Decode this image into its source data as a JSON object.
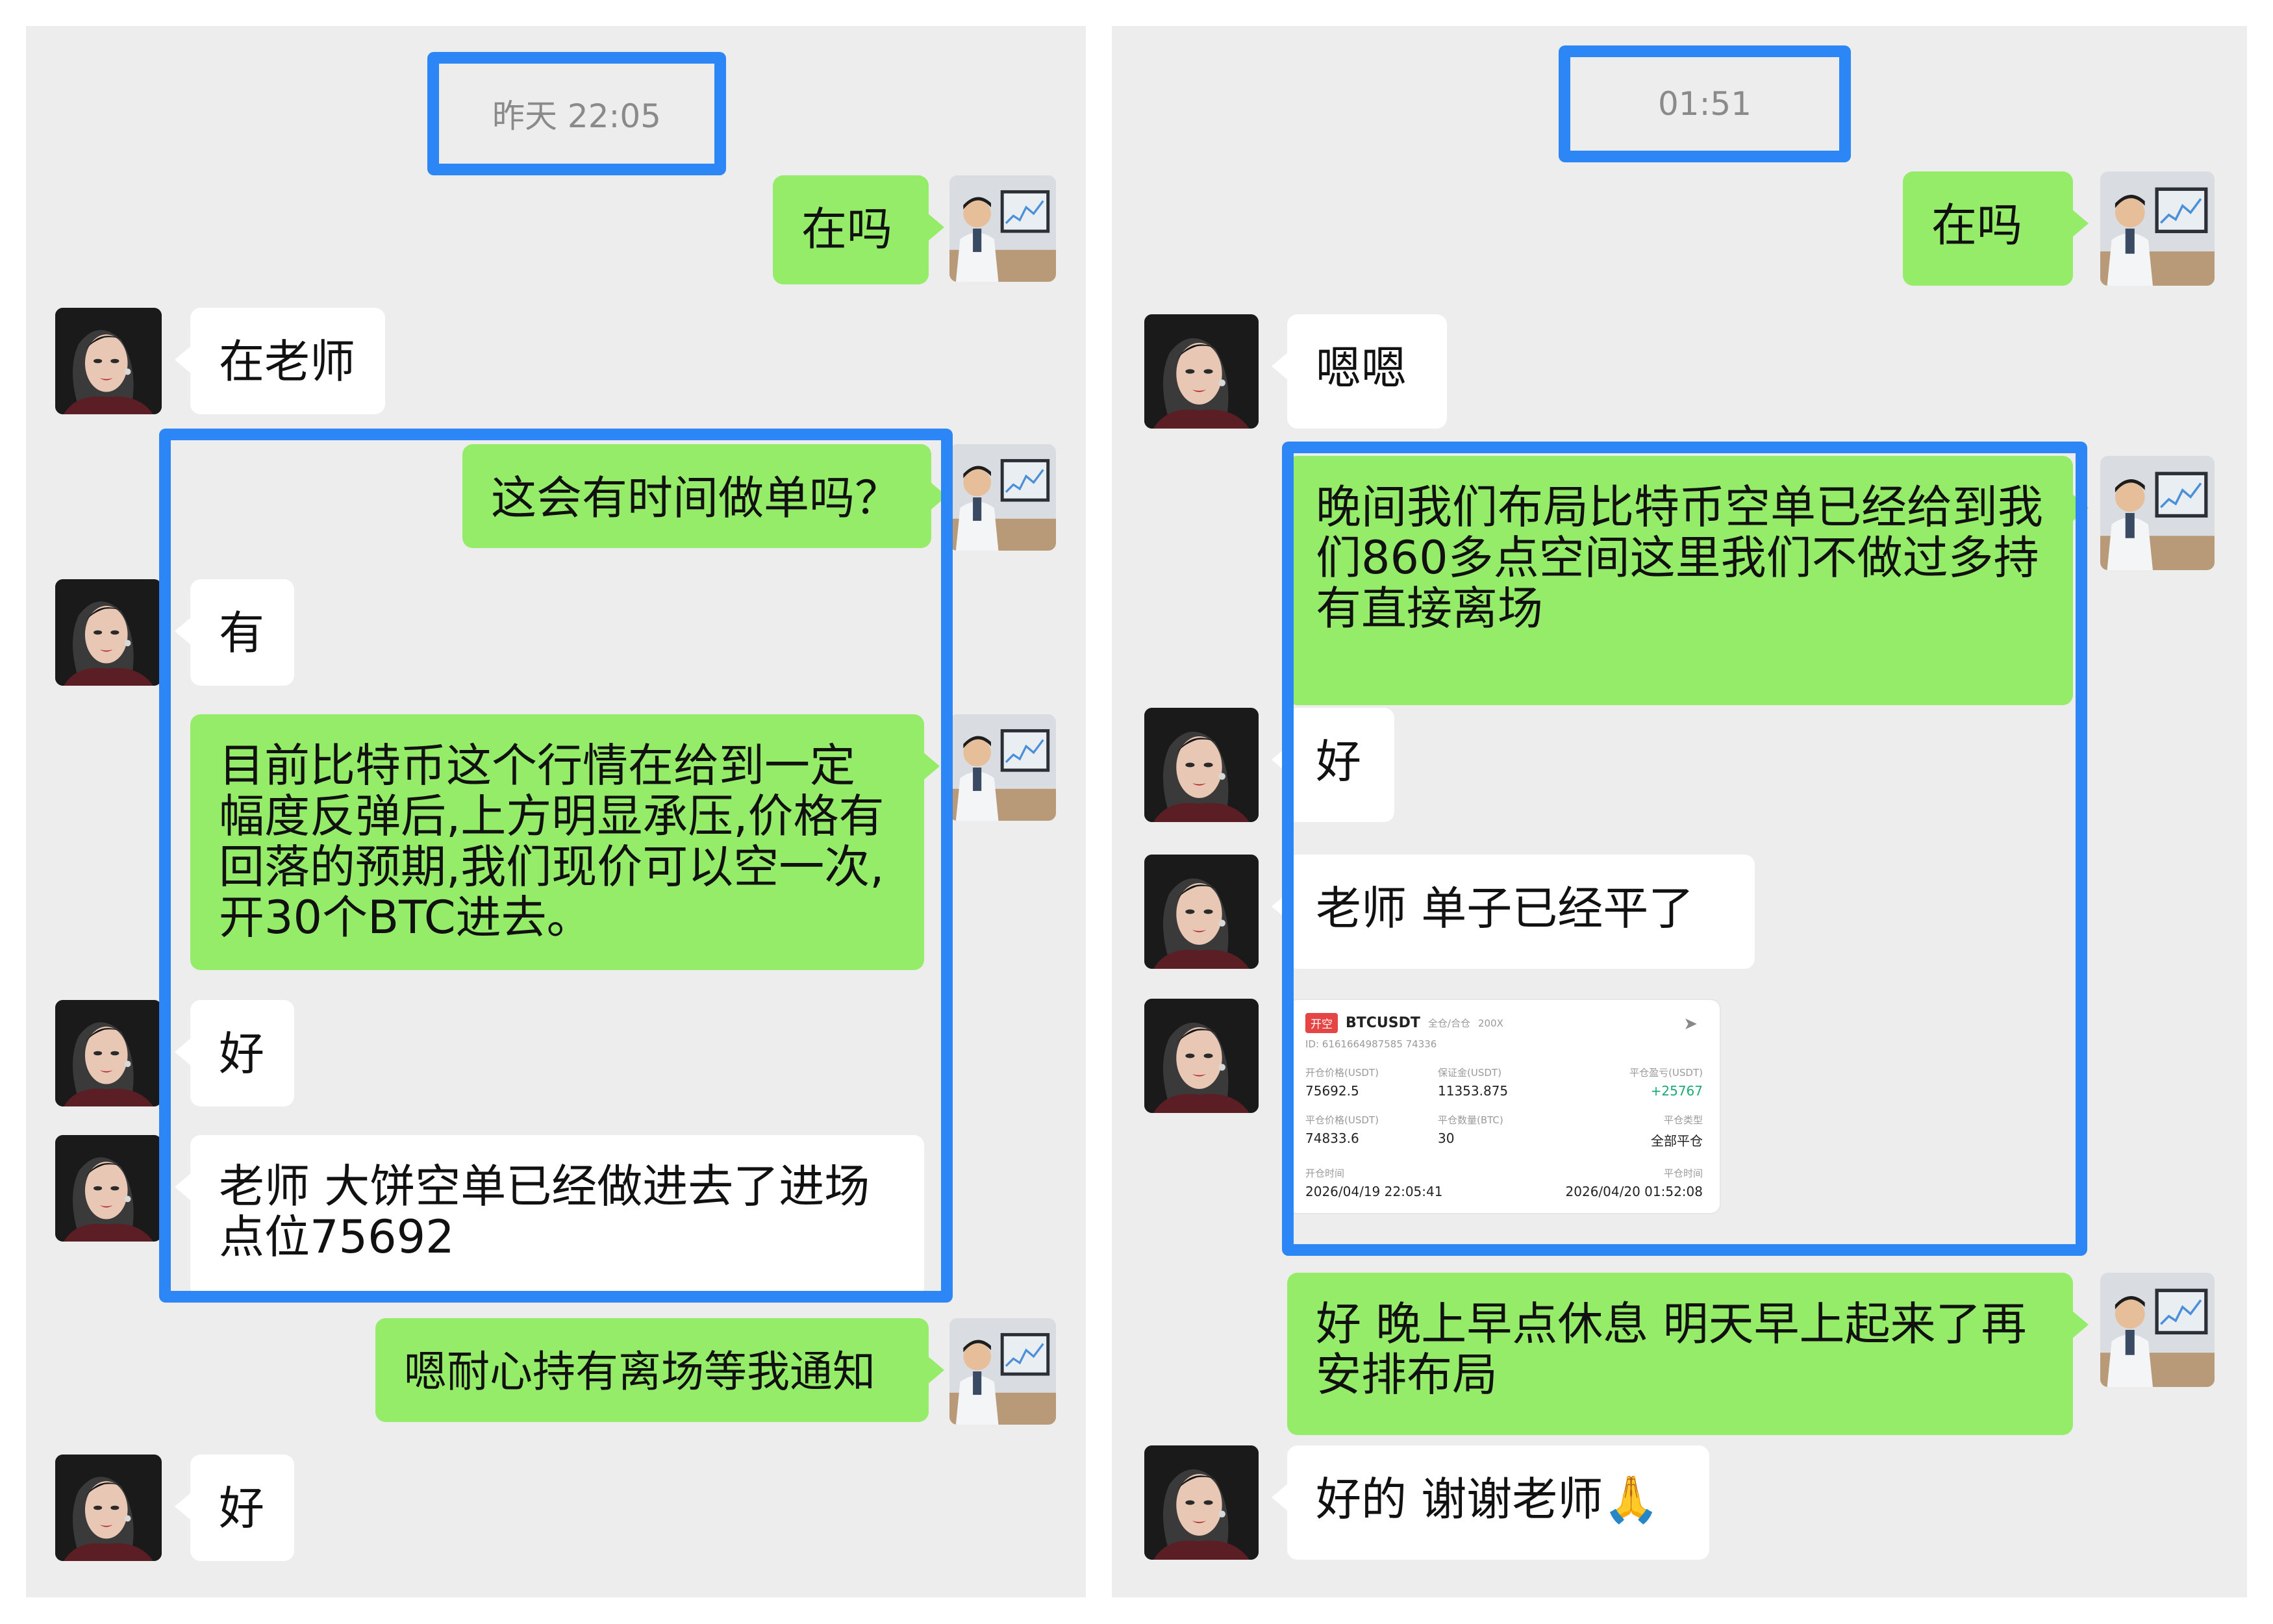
{
  "left": {
    "timestamp": "昨天 22:05",
    "messages": [
      {
        "text": "在吗"
      },
      {
        "text": "在老师"
      },
      {
        "text": "这会有时间做单吗？"
      },
      {
        "text": "有"
      },
      {
        "text": "目前比特币这个行情在给到一定幅度反弹后,上方明显承压,价格有回落的预期,我们现价可以空一次,开30个BTC进去。"
      },
      {
        "text": "好"
      },
      {
        "text": "老师 大饼空单已经做进去了进场点位75692"
      },
      {
        "text": "嗯耐心持有离场等我通知"
      },
      {
        "text": "好"
      }
    ]
  },
  "right": {
    "timestamp": "01:51",
    "messages": [
      {
        "text": "在吗"
      },
      {
        "text": "嗯嗯"
      },
      {
        "text": "晚间我们布局比特币空单已经给到我们860多点空间这里我们不做过多持有直接离场"
      },
      {
        "text": "好"
      },
      {
        "text": "老师 单子已经平了"
      },
      {
        "text": "好 晚上早点休息 明天早上起来了再安排布局"
      },
      {
        "text": "好的 谢谢老师"
      }
    ],
    "emoji": "🙏",
    "trade_card": {
      "tag": "开空",
      "pair": "BTCUSDT",
      "mode": "全仓/合仓",
      "leverage": "200X",
      "share_icon": "share-icon",
      "order_id": "ID: 6161664987585 74336",
      "open_price_label": "开仓价格(USDT)",
      "open_price": "75692.5",
      "margin_label": "保证金(USDT)",
      "margin": "11353.875",
      "pnl_label": "平仓盈亏(USDT)",
      "pnl": "+25767",
      "close_price_label": "平仓价格(USDT)",
      "close_price": "74833.6",
      "close_qty_label": "平仓数量(BTC)",
      "close_qty": "30",
      "close_type_label": "平仓类型",
      "close_type": "全部平仓",
      "open_time_label": "开仓时间",
      "open_time": "2026/04/19 22:05:41",
      "close_time_label": "平仓时间",
      "close_time": "2026/04/20 01:52:08"
    }
  },
  "colors": {
    "panel_bg": "#ededed",
    "outgoing_bubble": "#95ec69",
    "incoming_bubble": "#ffffff",
    "highlight_border": "#2c86f5",
    "profit_green": "#1aab72"
  }
}
